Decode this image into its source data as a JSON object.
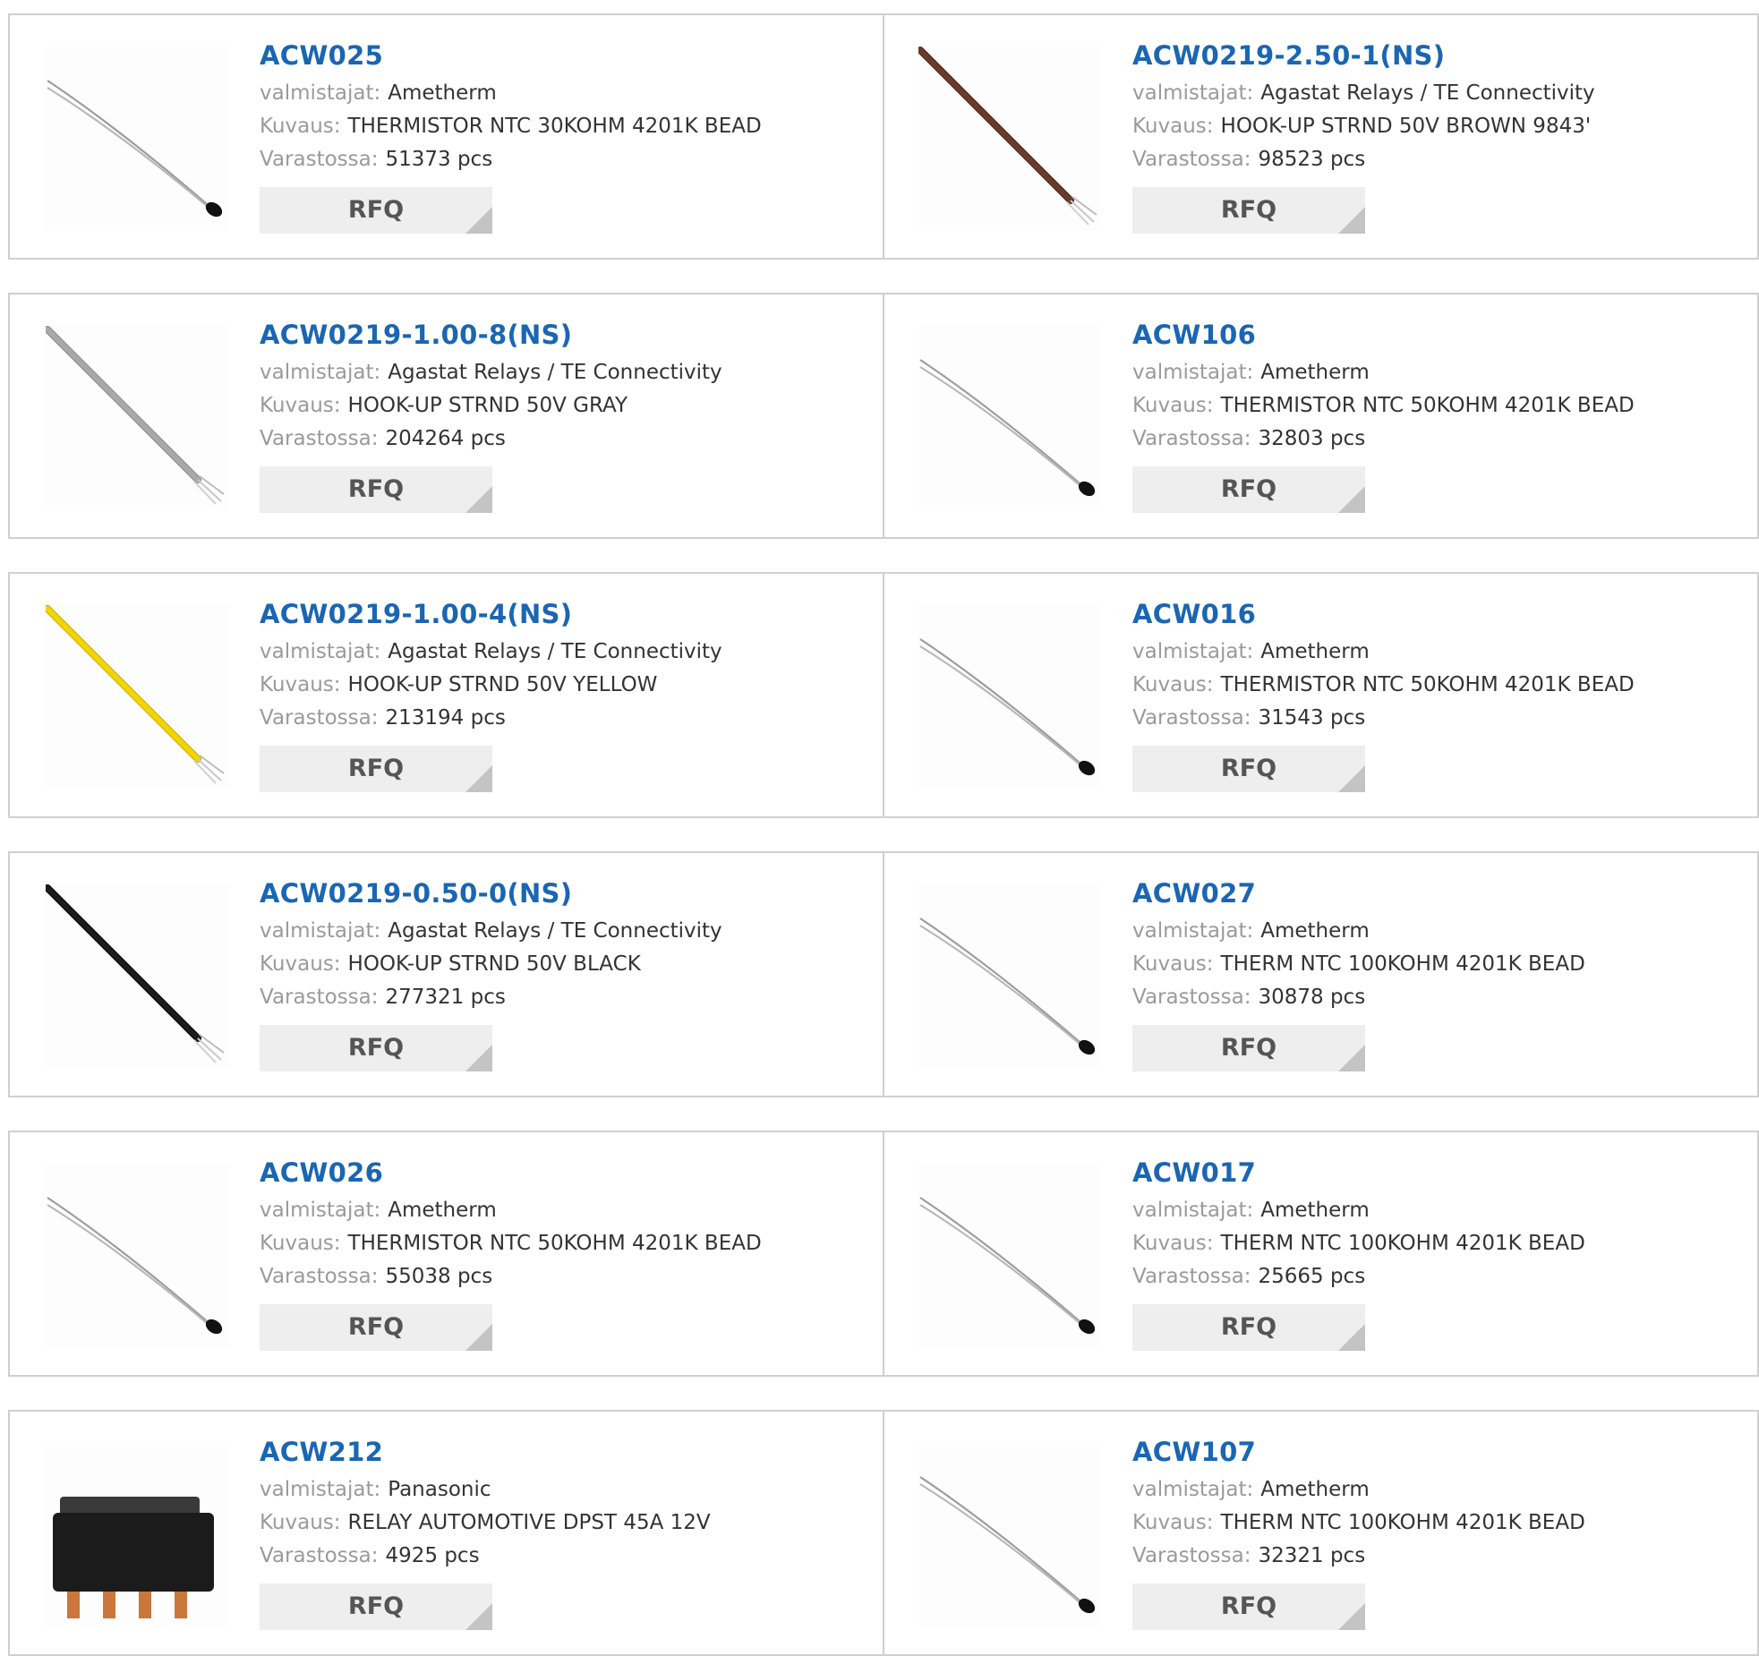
{
  "labels": {
    "manufacturer": "valmistajat:",
    "description": "Kuvaus:",
    "stock": "Varastossa:",
    "rfq": "RFQ"
  },
  "colors": {
    "part_link": "#1a66b3",
    "label": "#9a9a9a",
    "rfq_bg": "#eeeeee",
    "border": "#cfcfcf"
  },
  "products": [
    {
      "part": "ACW025",
      "manufacturer": "Ametherm",
      "description": "THERMISTOR NTC 30KOHM 4201K BEAD",
      "stock": "51373 pcs",
      "image": "thermistor-bead"
    },
    {
      "part": "ACW0219-2.50-1(NS)",
      "manufacturer": "Agastat Relays / TE Connectivity",
      "description": "HOOK-UP STRND 50V BROWN 9843'",
      "stock": "98523 pcs",
      "image": "wire-brown"
    },
    {
      "part": "ACW0219-1.00-8(NS)",
      "manufacturer": "Agastat Relays / TE Connectivity",
      "description": "HOOK-UP STRND 50V GRAY",
      "stock": "204264 pcs",
      "image": "wire-gray"
    },
    {
      "part": "ACW106",
      "manufacturer": "Ametherm",
      "description": "THERMISTOR NTC 50KOHM 4201K BEAD",
      "stock": "32803 pcs",
      "image": "thermistor-bead"
    },
    {
      "part": "ACW0219-1.00-4(NS)",
      "manufacturer": "Agastat Relays / TE Connectivity",
      "description": "HOOK-UP STRND 50V YELLOW",
      "stock": "213194 pcs",
      "image": "wire-yellow"
    },
    {
      "part": "ACW016",
      "manufacturer": "Ametherm",
      "description": "THERMISTOR NTC 50KOHM 4201K BEAD",
      "stock": "31543 pcs",
      "image": "thermistor-bead"
    },
    {
      "part": "ACW0219-0.50-0(NS)",
      "manufacturer": "Agastat Relays / TE Connectivity",
      "description": "HOOK-UP STRND 50V BLACK",
      "stock": "277321 pcs",
      "image": "wire-black"
    },
    {
      "part": "ACW027",
      "manufacturer": "Ametherm",
      "description": "THERM NTC 100KOHM 4201K BEAD",
      "stock": "30878 pcs",
      "image": "thermistor-bead"
    },
    {
      "part": "ACW026",
      "manufacturer": "Ametherm",
      "description": "THERMISTOR NTC 50KOHM 4201K BEAD",
      "stock": "55038 pcs",
      "image": "thermistor-bead"
    },
    {
      "part": "ACW017",
      "manufacturer": "Ametherm",
      "description": "THERM NTC 100KOHM 4201K BEAD",
      "stock": "25665 pcs",
      "image": "thermistor-bead"
    },
    {
      "part": "ACW212",
      "manufacturer": "Panasonic",
      "description": "RELAY AUTOMOTIVE DPST 45A 12V",
      "stock": "4925 pcs",
      "image": "relay"
    },
    {
      "part": "ACW107",
      "manufacturer": "Ametherm",
      "description": "THERM NTC 100KOHM 4201K BEAD",
      "stock": "32321 pcs",
      "image": "thermistor-bead"
    }
  ]
}
